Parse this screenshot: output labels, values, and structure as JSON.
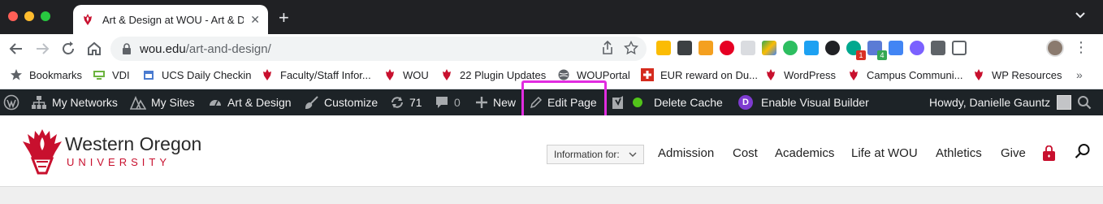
{
  "browser": {
    "tab_title": "Art & Design at WOU - Art & Design",
    "tab_close": "✕",
    "new_tab": "+",
    "url_domain": "wou.edu",
    "url_path": "/art-and-design/"
  },
  "bookmarks": [
    {
      "label": "Bookmarks",
      "icon": "star-icon"
    },
    {
      "label": "VDI",
      "icon": "vdi-icon"
    },
    {
      "label": "UCS Daily Checkin",
      "icon": "calendar-icon"
    },
    {
      "label": "Faculty/Staff Infor...",
      "icon": "wou-torch-icon"
    },
    {
      "label": "WOU",
      "icon": "wou-torch-icon"
    },
    {
      "label": "22 Plugin Updates",
      "icon": "wou-torch-icon"
    },
    {
      "label": "WOUPortal",
      "icon": "globe-icon"
    },
    {
      "label": "EUR reward on Du...",
      "icon": "swiss-flag-icon"
    },
    {
      "label": "WordPress",
      "icon": "wou-torch-icon"
    },
    {
      "label": "Campus Communi...",
      "icon": "wou-torch-icon"
    },
    {
      "label": "WP Resources",
      "icon": "wou-torch-icon"
    }
  ],
  "bookmarks_more": "»",
  "extensions": {
    "badge_one": "1",
    "badge_four": "4"
  },
  "adminbar": {
    "my_networks": "My Networks",
    "my_sites": "My Sites",
    "site_name": "Art & Design",
    "customize": "Customize",
    "updates_count": "71",
    "comments_count": "0",
    "new": "New",
    "edit_page": "Edit Page",
    "delete_cache": "Delete Cache",
    "divi_letter": "D",
    "visual_builder": "Enable Visual Builder",
    "howdy": "Howdy, Danielle Gauntz"
  },
  "site": {
    "logo_title": "Western Oregon",
    "logo_subtitle": "UNIVERSITY",
    "info_select": "Information for:",
    "nav": [
      "Admission",
      "Cost",
      "Academics",
      "Life at WOU",
      "Athletics",
      "Give"
    ]
  },
  "colors": {
    "wou_red": "#c8102e",
    "admin_bar": "#1d2327",
    "highlight": "#e12ce0"
  }
}
